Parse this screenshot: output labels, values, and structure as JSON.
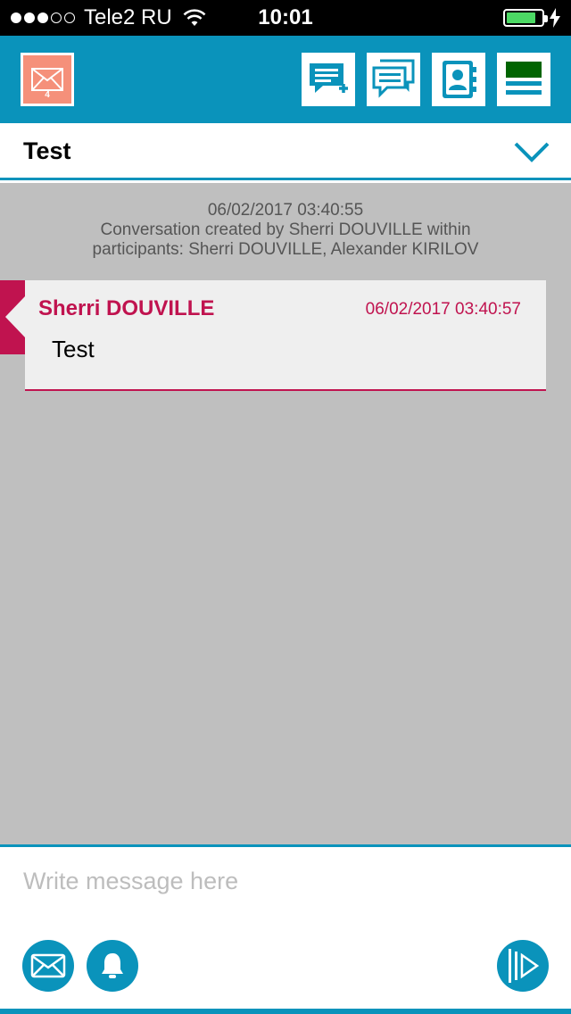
{
  "status_bar": {
    "carrier": "Tele2 RU",
    "time": "10:01",
    "signal_bars_filled": 3,
    "signal_bars_total": 5,
    "battery_level": 0.85
  },
  "toolbar": {
    "inbox_count": "4",
    "icons": [
      "inbox-icon",
      "new-message-icon",
      "conversations-icon",
      "contacts-icon",
      "menu-icon"
    ],
    "colors": {
      "bar": "#0a93bb",
      "inbox": "#f5907a",
      "menu_top": "#006400"
    }
  },
  "conversation": {
    "title": "Test",
    "system_message": {
      "timestamp": "06/02/2017 03:40:55",
      "line1": "Conversation created by Sherri DOUVILLE within",
      "line2": "participants: Sherri DOUVILLE, Alexander KIRILOV"
    },
    "messages": [
      {
        "author": "Sherri DOUVILLE",
        "timestamp": "06/02/2017 03:40:57",
        "text": "Test"
      }
    ],
    "accent_color": "#c0134f"
  },
  "composer": {
    "placeholder": "Write message here",
    "buttons": [
      "envelope-icon",
      "bell-icon",
      "send-play-icon"
    ]
  }
}
